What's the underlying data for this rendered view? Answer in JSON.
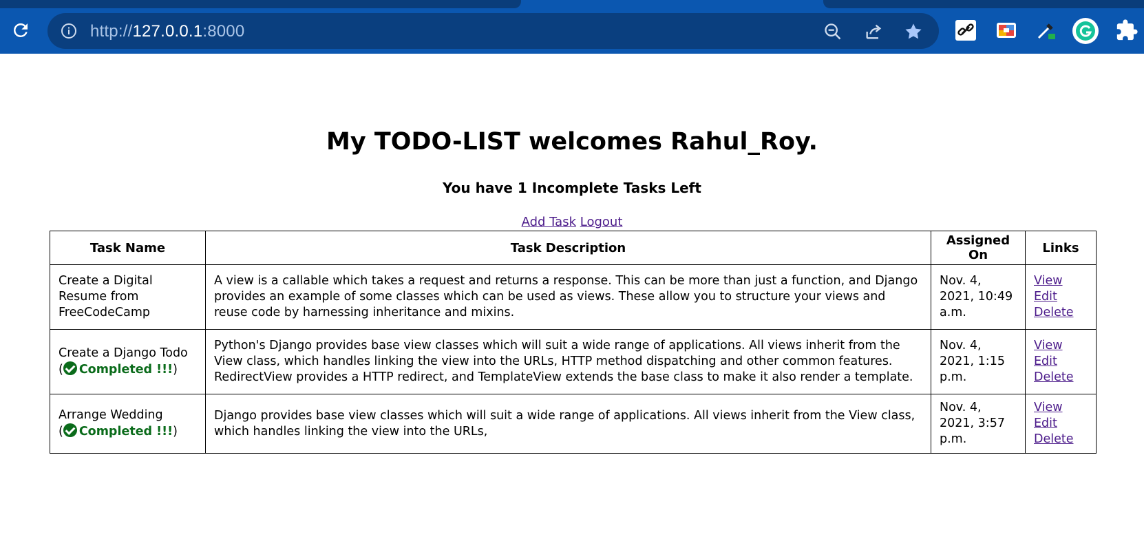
{
  "browser": {
    "url_scheme": "http://",
    "url_host": "127.0.0.1",
    "url_port": ":8000",
    "icons": [
      "reload-icon",
      "info-icon",
      "zoom-out-icon",
      "share-icon",
      "bookmark-star-icon",
      "link-extension-icon",
      "color-extension-icon",
      "eyedropper-extension-icon",
      "grammarly-extension-icon",
      "extensions-puzzle-icon"
    ],
    "colors": {
      "chrome": "#0b57b0",
      "omnibox": "#0a3f7f"
    }
  },
  "page": {
    "title": "My TODO-LIST welcomes Rahul_Roy.",
    "subtitle": "You have 1 Incomplete Tasks Left",
    "add_task_label": "Add Task",
    "logout_label": "Logout"
  },
  "table": {
    "headers": [
      "Task Name",
      "Task Description",
      "Assigned On",
      "Links"
    ],
    "rows": [
      {
        "name": "Create a Digital Resume from FreeCodeCamp",
        "completed_label": "",
        "description": "A view is a callable which takes a request and returns a response. This can be more than just a function, and Django provides an example of some classes which can be used as views. These allow you to structure your views and reuse code by harnessing inheritance and mixins.",
        "assigned_on": "Nov. 4, 2021, 10:49 a.m.",
        "links": {
          "view": "View",
          "edit": "Edit",
          "delete": "Delete"
        }
      },
      {
        "name": "Create a Django Todo",
        "completed_label": "Completed !!!",
        "description": "Python's Django provides base view classes which will suit a wide range of applications. All views inherit from the View class, which handles linking the view into the URLs, HTTP method dispatching and other common features. RedirectView provides a HTTP redirect, and TemplateView extends the base class to make it also render a template.",
        "assigned_on": "Nov. 4, 2021, 1:15 p.m.",
        "links": {
          "view": "View",
          "edit": "Edit",
          "delete": "Delete"
        }
      },
      {
        "name": "Arrange Wedding",
        "completed_label": "Completed !!!",
        "description": "Django provides base view classes which will suit a wide range of applications. All views inherit from the View class, which handles linking the view into the URLs,",
        "assigned_on": "Nov. 4, 2021, 3:57 p.m.",
        "links": {
          "view": "View",
          "edit": "Edit",
          "delete": "Delete"
        }
      }
    ]
  }
}
